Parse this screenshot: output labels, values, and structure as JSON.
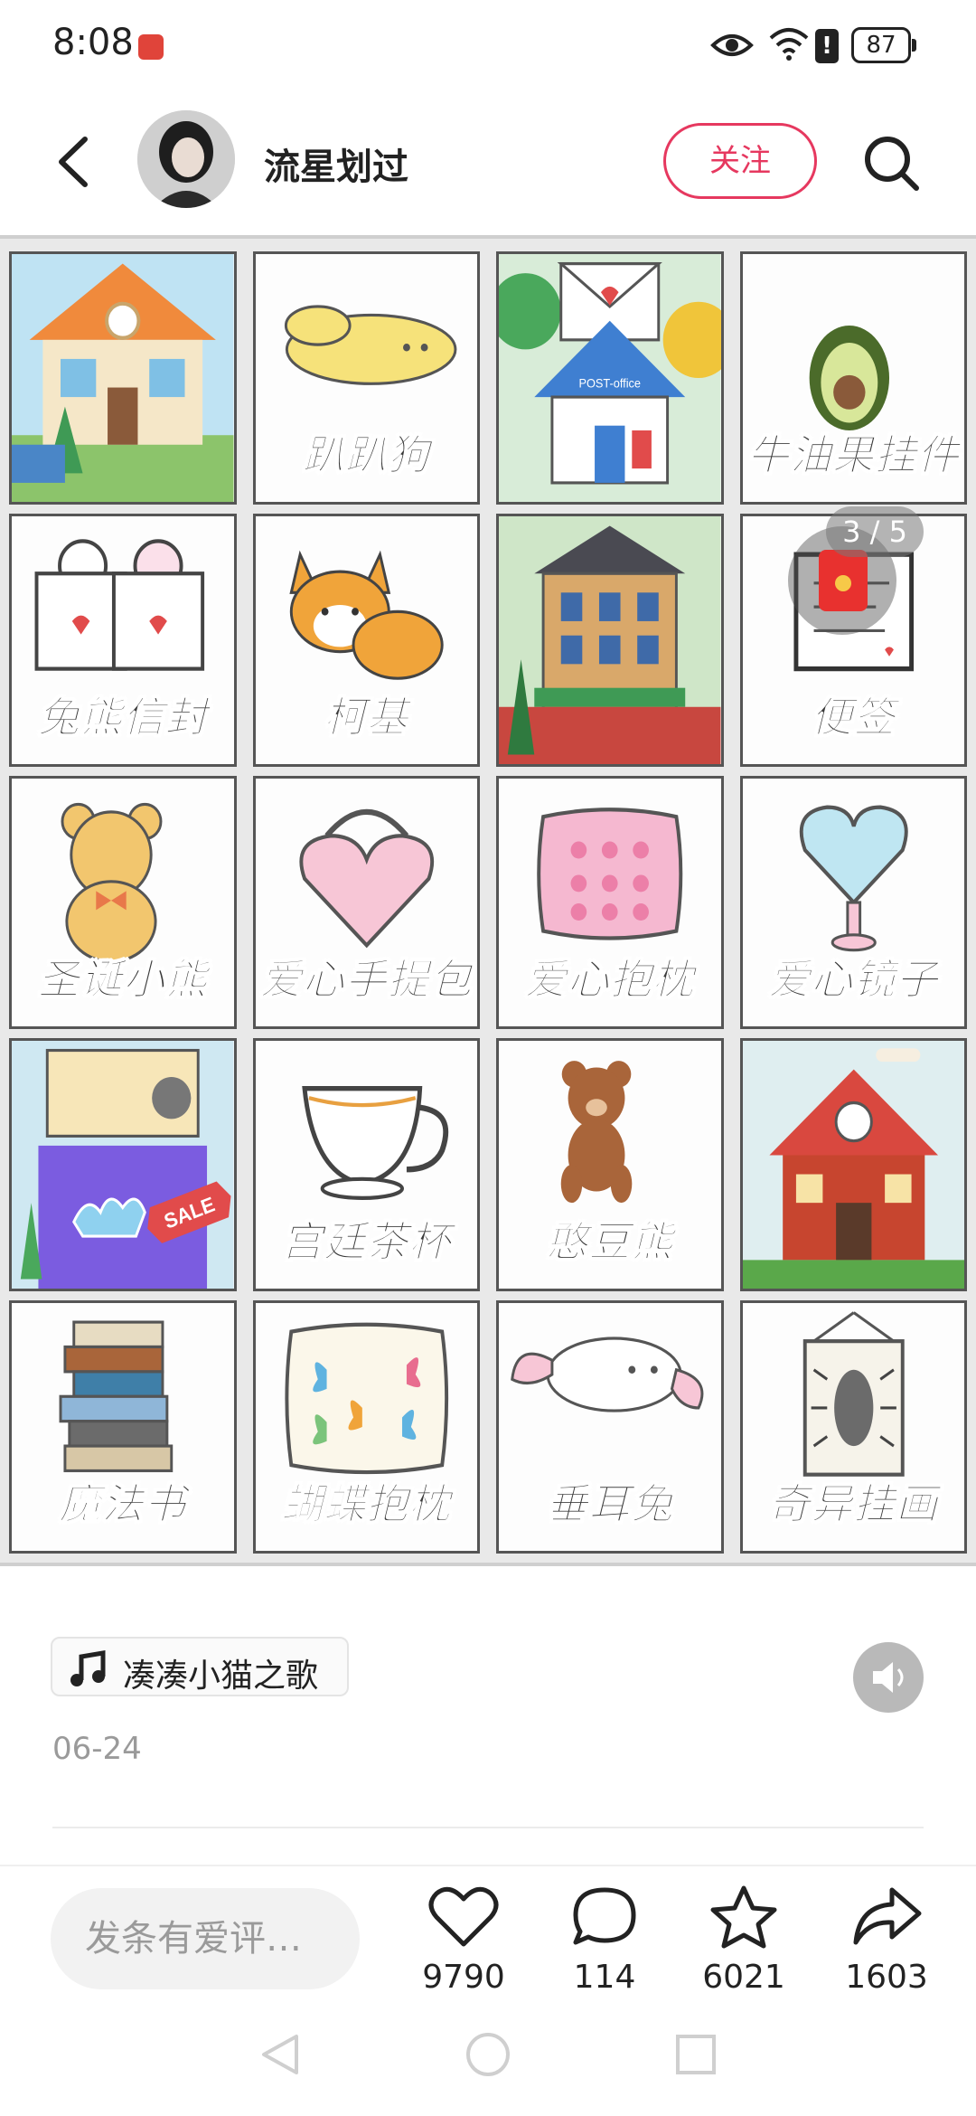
{
  "status_bar": {
    "time": "8:08",
    "battery": "87",
    "icons": [
      "notification-icon",
      "eye-icon",
      "wifi-icon",
      "alert-icon",
      "battery-icon"
    ]
  },
  "header": {
    "username": "流星划过",
    "follow_label": "关注",
    "accent_color": "#e6385f"
  },
  "gallery": {
    "page_indicator": "3 / 5",
    "tiles": [
      {
        "label": "",
        "art": "house"
      },
      {
        "label": "趴趴狗",
        "art": "dog"
      },
      {
        "label": "",
        "art": "post-office"
      },
      {
        "label": "牛油果挂件",
        "art": "avocado"
      },
      {
        "label": "兔熊信封",
        "art": "envelopes"
      },
      {
        "label": "柯基",
        "art": "corgi"
      },
      {
        "label": "",
        "art": "building"
      },
      {
        "label": "便签",
        "art": "note"
      },
      {
        "label": "圣诞小熊",
        "art": "bear"
      },
      {
        "label": "爱心手提包",
        "art": "bag"
      },
      {
        "label": "爱心抱枕",
        "art": "pillow"
      },
      {
        "label": "爱心镜子",
        "art": "mirror"
      },
      {
        "label": "",
        "art": "shop"
      },
      {
        "label": "宫廷茶杯",
        "art": "cup"
      },
      {
        "label": "憨豆熊",
        "art": "teddy"
      },
      {
        "label": "",
        "art": "red-house"
      },
      {
        "label": "魔法书",
        "art": "books"
      },
      {
        "label": "蝴蝶抱枕",
        "art": "butterfly"
      },
      {
        "label": "垂耳兔",
        "art": "bunny"
      },
      {
        "label": "奇异挂画",
        "art": "painting"
      }
    ],
    "sale_text": "SALE",
    "post_office_text": "POST-office"
  },
  "post": {
    "music": "凑凑小猫之歌",
    "date": "06-24"
  },
  "actions": {
    "comment_placeholder": "发条有爱评…",
    "likes": "9790",
    "comments": "114",
    "favorites": "6021",
    "shares": "1603"
  }
}
